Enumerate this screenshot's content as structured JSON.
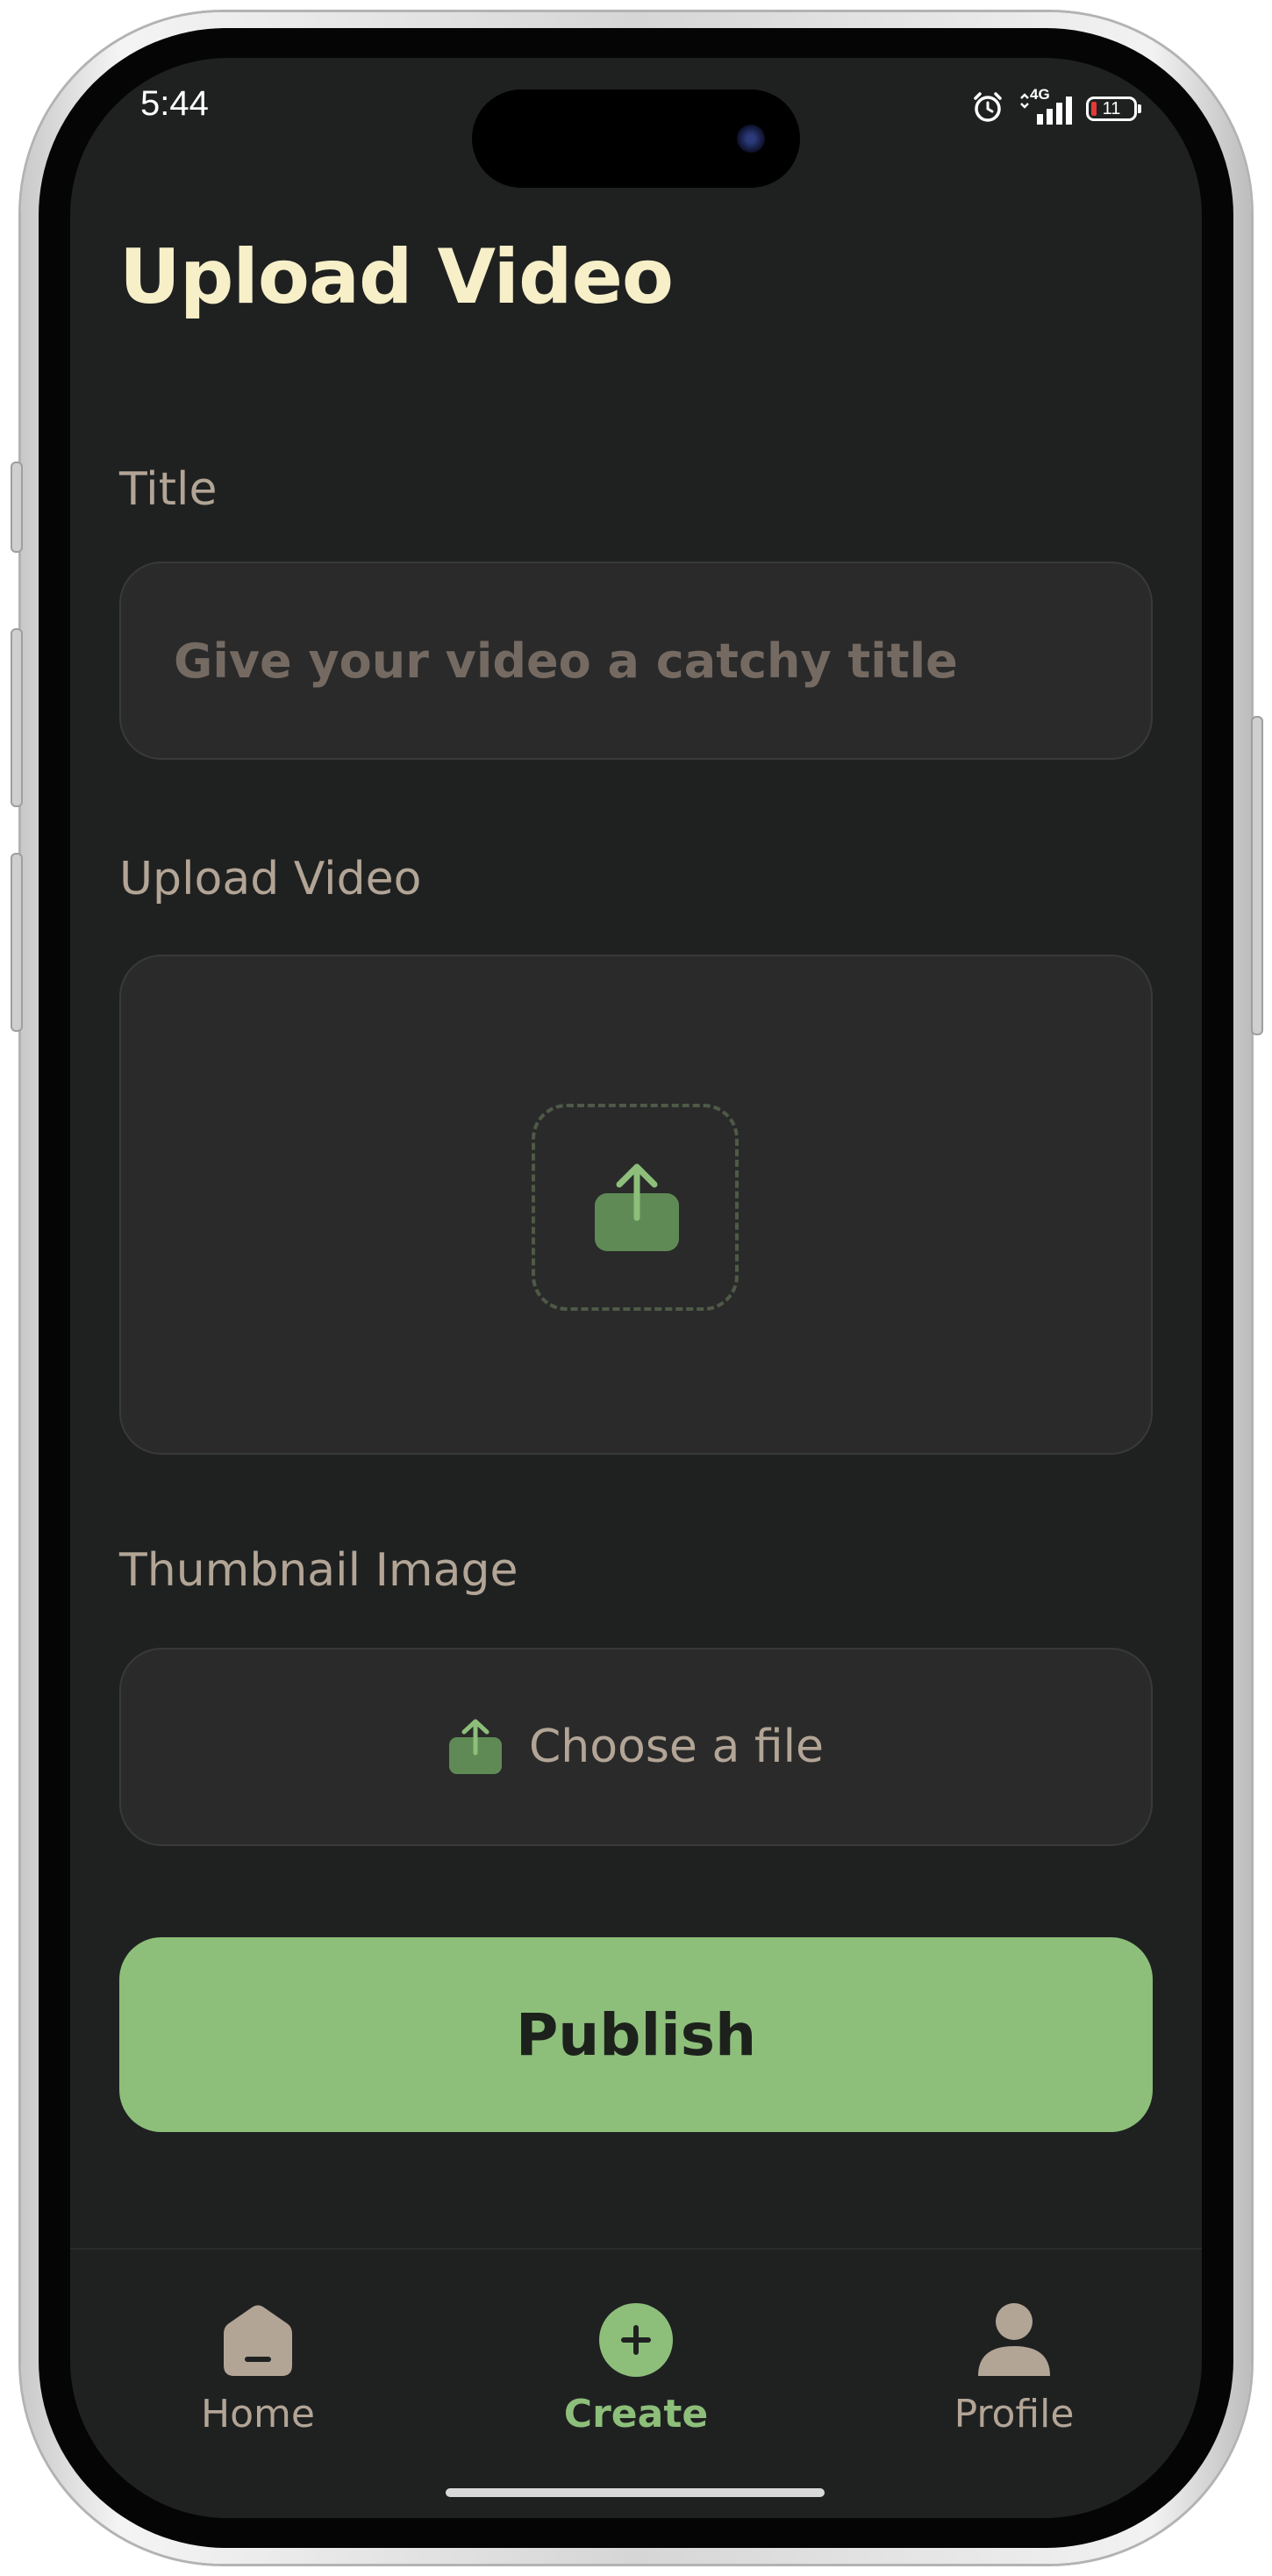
{
  "status_bar": {
    "time": "5:44",
    "network": "4G",
    "battery_level": "11"
  },
  "page": {
    "title": "Upload Video"
  },
  "form": {
    "title_label": "Title",
    "title_placeholder": "Give your video a catchy title",
    "title_value": "",
    "video_label": "Upload Video",
    "thumbnail_label": "Thumbnail Image",
    "thumbnail_button_label": "Choose a file",
    "publish_label": "Publish"
  },
  "nav": {
    "items": [
      {
        "label": "Home",
        "icon": "home-icon",
        "active": false
      },
      {
        "label": "Create",
        "icon": "plus-circle-icon",
        "active": true
      },
      {
        "label": "Profile",
        "icon": "profile-icon",
        "active": false
      }
    ]
  },
  "colors": {
    "background": "#1f2121",
    "accent_green": "#8dbf7a",
    "title_cream": "#f7efc8",
    "label_tan": "#b3a596",
    "field_bg": "#2a2a2a"
  }
}
